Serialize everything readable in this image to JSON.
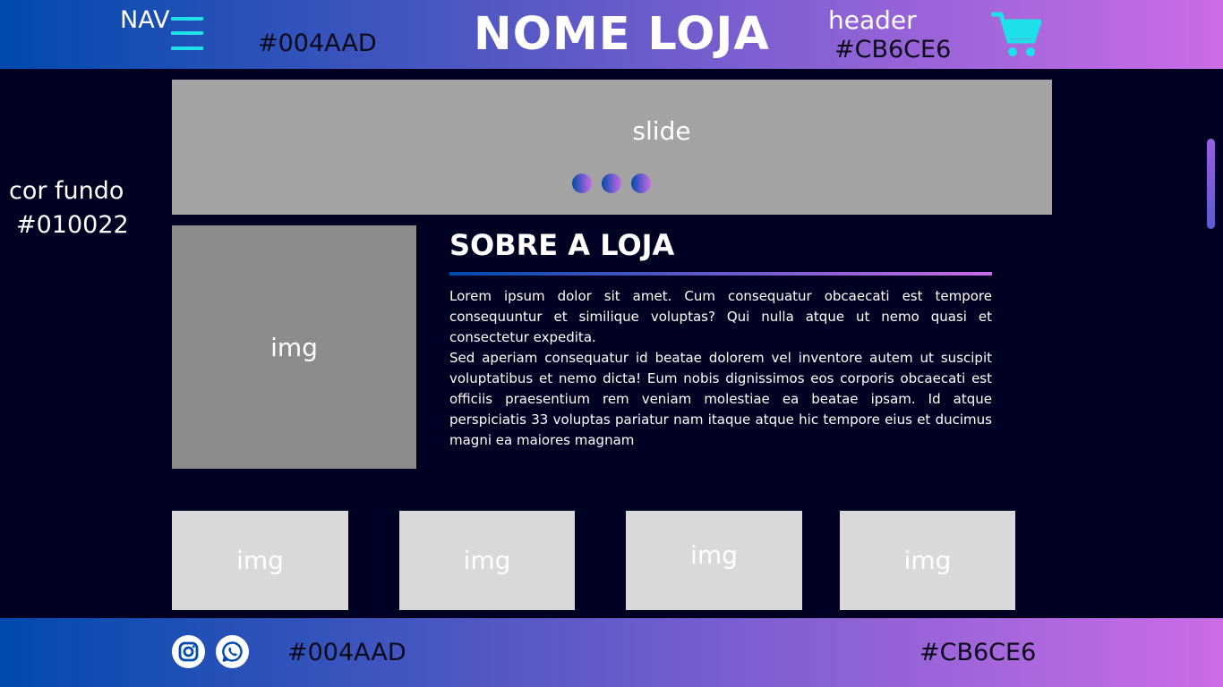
{
  "header": {
    "nav_label": "NAV",
    "color_left": "#004AAD",
    "store_name": "NOME LOJA",
    "header_label": "header",
    "color_right": "#CB6CE6",
    "menu_icon": "hamburger-menu-icon",
    "cart_icon": "shopping-cart-icon",
    "accent_color": "#1de0e8"
  },
  "background": {
    "label": "cor fundo",
    "color": "#010022"
  },
  "slide": {
    "label": "slide",
    "dots": 3
  },
  "about": {
    "image_label": "img",
    "title": "SOBRE A LOJA",
    "paragraphs": [
      "Lorem ipsum dolor sit amet. Cum consequatur obcaecati est tempore consequuntur et similique voluptas? Qui nulla atque ut nemo quasi et consectetur expedita.",
      "Sed aperiam consequatur id beatae dolorem vel inventore autem ut suscipit voluptatibus et nemo dicta! Eum nobis dignissimos eos corporis obcaecati est officiis praesentium rem veniam molestiae ea beatae ipsam. Id atque perspiciatis 33 voluptas pariatur nam itaque atque hic tempore eius et ducimus magni ea maiores magnam"
    ]
  },
  "gallery": {
    "items": [
      {
        "label": "img"
      },
      {
        "label": "img"
      },
      {
        "label": "img"
      },
      {
        "label": "img"
      }
    ]
  },
  "footer": {
    "icons": [
      "instagram-icon",
      "whatsapp-icon"
    ],
    "color_left": "#004AAD",
    "color_right": "#CB6CE6"
  },
  "colors": {
    "gradient_start": "#004AAD",
    "gradient_end": "#CB6CE6",
    "slide_bg": "#a3a3a3",
    "about_img_bg": "#8c8c8c",
    "gallery_bg": "#d9d9d9"
  }
}
